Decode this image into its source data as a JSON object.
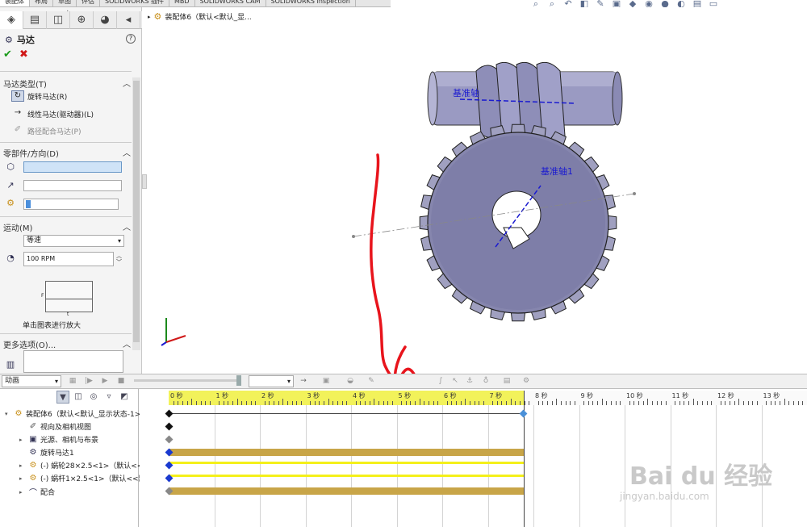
{
  "top_tabs": [
    "装配体",
    "布局",
    "草图",
    "评估",
    "SOLIDWORKS 插件",
    "MBD",
    "SOLIDWORKS CAM",
    "SOLIDWORKS Inspection"
  ],
  "property_manager": {
    "title": "马达",
    "sections": {
      "motor_type": {
        "label": "马达类型(T)",
        "options": [
          {
            "label": "旋转马达(R)",
            "selected": true
          },
          {
            "label": "线性马达(驱动器)(L)",
            "selected": false
          },
          {
            "label": "路径配合马达(P)",
            "selected": false
          }
        ]
      },
      "component_direction": {
        "label": "零部件/方向(D)"
      },
      "motion": {
        "label": "运动(M)",
        "type_value": "等速",
        "speed_value": "100 RPM",
        "graph_f": "F",
        "graph_t": "t",
        "graph_caption": "单击图表进行放大"
      },
      "more_options": {
        "label": "更多选项(O)..."
      }
    }
  },
  "viewport": {
    "tree_label": "装配体6（默认<默认_显...",
    "labels": {
      "axis_top": "基准轴",
      "axis_gear": "基准轴1"
    }
  },
  "motion_manager": {
    "study_type": "动画",
    "time_labels": [
      "0 秒",
      "1 秒",
      "2 秒",
      "3 秒",
      "4 秒",
      "5 秒",
      "6 秒",
      "7 秒",
      "8 秒",
      "9 秒",
      "10 秒",
      "11 秒",
      "12 秒",
      "13 秒",
      "14"
    ],
    "tree": [
      {
        "label": "装配体6（默认<默认_显示状态-1>",
        "expand": "▾",
        "indent": 0
      },
      {
        "label": "视向及相机视图",
        "expand": "",
        "indent": 1
      },
      {
        "label": "光源、相机与布景",
        "expand": "▸",
        "indent": 1
      },
      {
        "label": "旋转马达1",
        "expand": "",
        "indent": 1
      },
      {
        "label": "(-) 蜗轮28×2.5<1>（默认<<默",
        "expand": "▸",
        "indent": 1
      },
      {
        "label": "(-) 蜗杆1×2.5<1>（默认<<默",
        "expand": "▸",
        "indent": 1
      },
      {
        "label": "配合",
        "expand": "▸",
        "indent": 1
      }
    ]
  },
  "watermark": {
    "main": "Bai du 经验",
    "sub": "jingyan.baidu.com"
  },
  "colors": {
    "ruler_active": "#f2f25a",
    "bar_gold": "#c8a548",
    "bar_yellow": "#f4f01a",
    "sketch_red": "#e8141c",
    "axis_blue": "#1a1ad0"
  }
}
